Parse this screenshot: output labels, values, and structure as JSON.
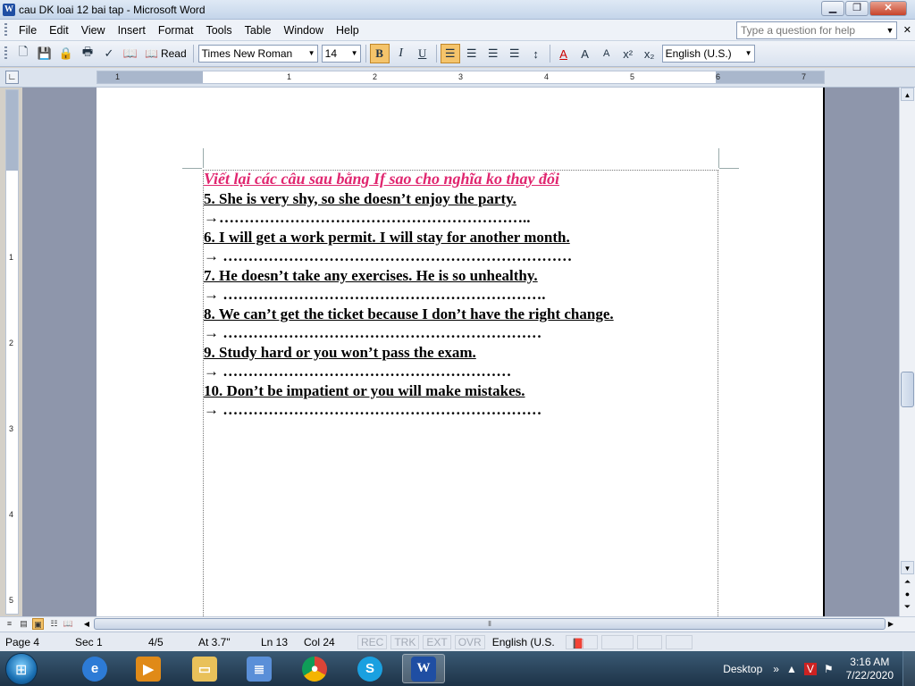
{
  "window": {
    "title": "cau DK loai 12 bai tap - Microsoft Word",
    "app_icon": "W"
  },
  "menu": [
    "File",
    "Edit",
    "View",
    "Insert",
    "Format",
    "Tools",
    "Table",
    "Window",
    "Help"
  ],
  "help_box": {
    "placeholder": "Type a question for help"
  },
  "toolbar": {
    "read_label": "Read",
    "font_name": "Times New Roman",
    "font_size": "14",
    "bold": "B",
    "italic": "I",
    "underline": "U",
    "language": "English (U.S.)"
  },
  "ruler": {
    "numbers": [
      "1",
      "1",
      "2",
      "3",
      "4",
      "5",
      "6",
      "7"
    ],
    "vertical_numbers": [
      "1",
      "2",
      "3",
      "4",
      "5"
    ]
  },
  "document": {
    "heading": "Viết lại các câu sau bằng If sao cho nghĩa ko thay đổi",
    "items": [
      {
        "question": "5. She is very shy, so she doesn’t enjoy the party.",
        "answer": "→…………………………………………………….."
      },
      {
        "question": "6. I will get a work permit. I will stay for another month.",
        "answer": "→ ……………………………………………………………"
      },
      {
        "question": "7. He doesn’t take any exercises. He is so unhealthy.",
        "answer": "→ ………………………………………………………."
      },
      {
        "question": "8. We can’t get the ticket because I don’t have the right change.",
        "answer": "→ ………………………………………………………"
      },
      {
        "question": "9. Study hard or you won’t pass the exam.",
        "answer": "→ …………………………………………………"
      },
      {
        "question": "10. Don’t be impatient or you will make mistakes.",
        "answer": "→ ………………………………………………………"
      }
    ]
  },
  "status": {
    "page": "Page 4",
    "sec": "Sec 1",
    "pages": "4/5",
    "at": "At 3.7\"",
    "ln": "Ln 13",
    "col": "Col 24",
    "rec": "REC",
    "trk": "TRK",
    "ext": "EXT",
    "ovr": "OVR",
    "language": "English (U.S."
  },
  "taskbar": {
    "desktop_label": "Desktop",
    "time": "3:16 AM",
    "date": "7/22/2020"
  },
  "colors": {
    "heading": "#e0266f",
    "active_button": "#f5c46b"
  }
}
